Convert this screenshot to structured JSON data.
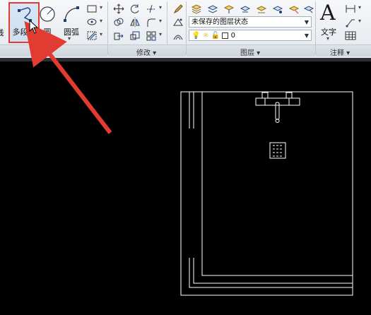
{
  "ribbon": {
    "draw": {
      "line_label": "线",
      "polyline_label": "多段线",
      "circle_label": "圆",
      "arc_label": "圆弧",
      "title": "绘图"
    },
    "modify": {
      "title": "修改"
    },
    "layers": {
      "layer_state_value": "未保存的图层状态",
      "layer_current_value": "0",
      "title": "图层"
    },
    "annotation": {
      "text_label": "文字",
      "title": "注释"
    }
  },
  "colors": {
    "highlight": "#e23b32",
    "canvas": "#000000",
    "drawing_lines": "#ffffff"
  }
}
